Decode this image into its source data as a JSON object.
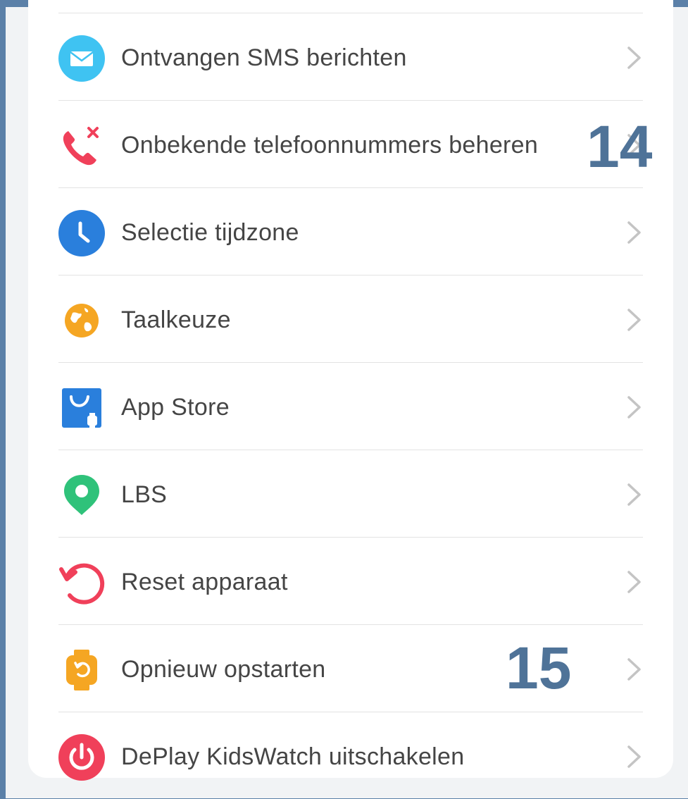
{
  "settings": {
    "items": [
      {
        "label": "Ontvangen SMS berichten",
        "icon": "envelope-icon",
        "color": "#3fc3f2"
      },
      {
        "label": "Onbekende telefoonnummers beheren",
        "icon": "blocked-call-icon",
        "color": "#f0405a"
      },
      {
        "label": "Selectie tijdzone",
        "icon": "clock-icon",
        "color": "#2a7fdc"
      },
      {
        "label": "Taalkeuze",
        "icon": "globe-icon",
        "color": "#f5a623"
      },
      {
        "label": "App Store",
        "icon": "shopping-bag-icon",
        "color": "#2a7fdc"
      },
      {
        "label": "LBS",
        "icon": "location-pin-icon",
        "color": "#2fc27a"
      },
      {
        "label": "Reset apparaat",
        "icon": "reset-icon",
        "color": "#f0405a"
      },
      {
        "label": "Opnieuw opstarten",
        "icon": "watch-restart-icon",
        "color": "#f5a623"
      },
      {
        "label": "DePlay KidsWatch uitschakelen",
        "icon": "power-icon",
        "color": "#f0405a"
      }
    ]
  },
  "annotations": {
    "marker_14": "14",
    "marker_15": "15"
  }
}
